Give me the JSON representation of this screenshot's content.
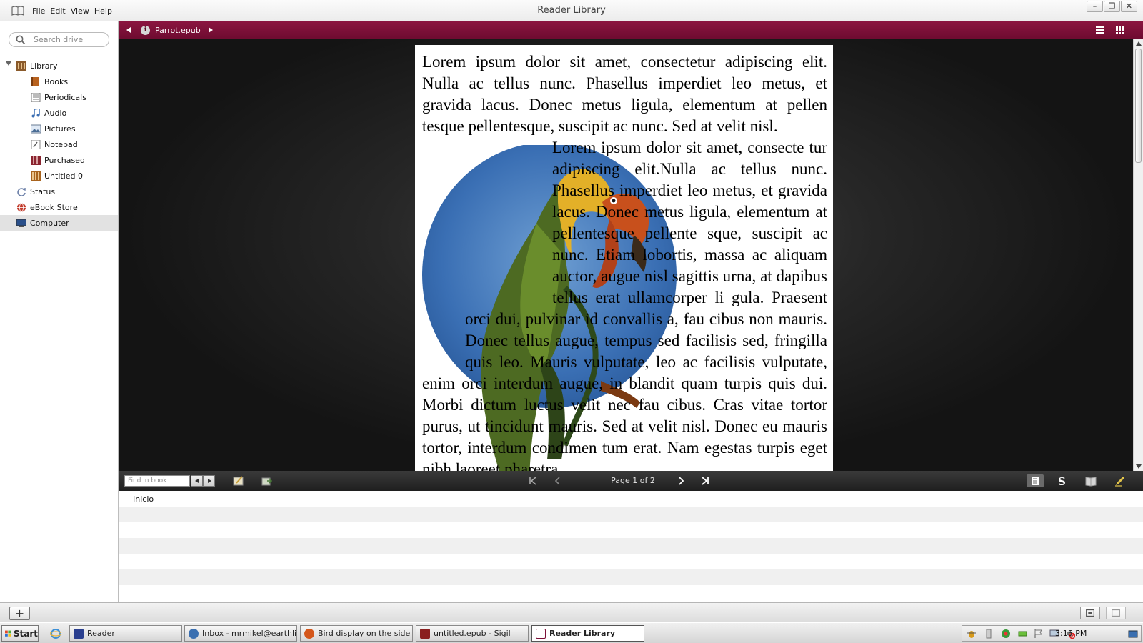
{
  "window": {
    "title": "Reader Library",
    "menu": [
      "File",
      "Edit",
      "View",
      "Help"
    ],
    "controls": [
      "minimize",
      "restore",
      "close"
    ]
  },
  "sidebar": {
    "search_placeholder": "Search drive",
    "items": [
      {
        "label": "Library",
        "icon": "library-icon"
      },
      {
        "label": "Books",
        "icon": "books-icon"
      },
      {
        "label": "Periodicals",
        "icon": "periodicals-icon"
      },
      {
        "label": "Audio",
        "icon": "audio-icon"
      },
      {
        "label": "Pictures",
        "icon": "pictures-icon"
      },
      {
        "label": "Notepad",
        "icon": "notepad-icon"
      },
      {
        "label": "Purchased",
        "icon": "purchased-icon"
      },
      {
        "label": "Untitled 0",
        "icon": "collection-icon"
      },
      {
        "label": "Status",
        "icon": "sync-icon"
      },
      {
        "label": "eBook Store",
        "icon": "globe-icon"
      },
      {
        "label": "Computer",
        "icon": "computer-icon"
      }
    ],
    "selected": "Computer"
  },
  "reader": {
    "document": "Parrot.epub",
    "accent": "#7c1038",
    "paragraph1": "Lorem ipsum dolor sit amet, consectetur adipiscing elit. Nulla ac tellus nunc. Phasellus imperdiet leo metus, et gravida lacus. Donec metus ligula, elementum at pellen tesque pellentesque, suscipit ac nunc. Sed at velit nisl.",
    "paragraph2": "Lorem ipsum dolor sit amet, consecte tur adipiscing elit.Nulla ac tellus nunc. Phasellus imperdiet leo metus, et gravida lacus. Donec metus ligula, elementum at pellentesque pellente sque, suscipit ac nunc. Etiam lobortis, massa ac aliquam auctor, augue nisl sagittis urna, at dapibus tellus erat ullamcorper li gula. Praesent orci dui, pulvinar id convallis a, fau cibus non mauris. Donec tellus augue, tempus sed facilisis sed, fringilla quis leo. Mauris vulputate, leo ac facilisis vulputate, enim orci interdum augue, in blandit quam turpis quis dui. Morbi dictum luctus velit nec fau cibus. Cras vitae tortor purus, ut tincidunt mauris. Sed at velit nisl. Donec eu mauris tortor, interdum condimen tum erat. Nam egestas turpis eget nibh laoreet pharetra."
  },
  "footer": {
    "find_placeholder": "Find in book",
    "page_indicator": "Page 1 of 2"
  },
  "contents": {
    "entries": [
      "Inicio"
    ]
  },
  "taskbar": {
    "start": "Start",
    "tasks": [
      {
        "label": "Reader",
        "color": "#2a3f8f"
      },
      {
        "label": "Inbox - mrmikel@earthlin...",
        "color": "#3a6fb0"
      },
      {
        "label": "Bird display on the side o...",
        "color": "#d4561a"
      },
      {
        "label": "untitled.epub - Sigil",
        "color": "#8a1f1f"
      },
      {
        "label": "Reader Library",
        "color": "#7c1038"
      }
    ],
    "clock": "3:15 PM"
  }
}
